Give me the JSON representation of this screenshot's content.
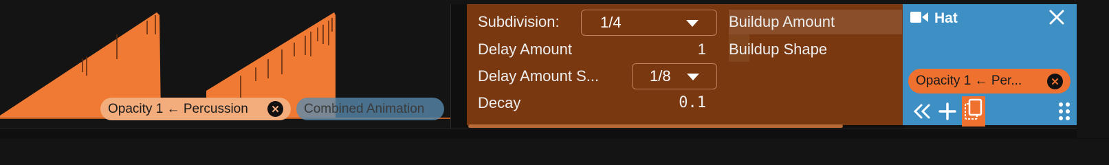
{
  "timeline": {
    "chips": [
      {
        "label": "Opacity 1 ← Percussion",
        "remove_icon": "close-icon"
      },
      {
        "label": "Combined Animation"
      }
    ],
    "colors": {
      "waveform": "#f07a33",
      "chip_active": "#f3ac7b",
      "chip_other": "#588ab0"
    }
  },
  "settings": {
    "subdivision": {
      "label": "Subdivision:",
      "value": "1/4"
    },
    "delay_amount": {
      "label": "Delay Amount",
      "value": "1"
    },
    "delay_amount_subdivision": {
      "label": "Delay Amount S...",
      "value": "1/8"
    },
    "decay": {
      "label": "Decay",
      "value": "0.1"
    },
    "buildup_amount": {
      "label": "Buildup Amount"
    },
    "buildup_shape": {
      "label": "Buildup Shape"
    },
    "colors": {
      "panel": "#7a3810"
    }
  },
  "hat": {
    "title": "Hat",
    "camera_icon": "camera-icon",
    "close_icon": "close-icon",
    "chip": {
      "label": "Opacity 1 ← Per...",
      "remove_icon": "close-icon"
    },
    "toolbar": [
      "collapse-left-icon",
      "add-icon",
      "duplicate-icon",
      "drag-handle-icon"
    ],
    "colors": {
      "panel": "#3e8fc4",
      "accent": "#ee7130"
    }
  }
}
